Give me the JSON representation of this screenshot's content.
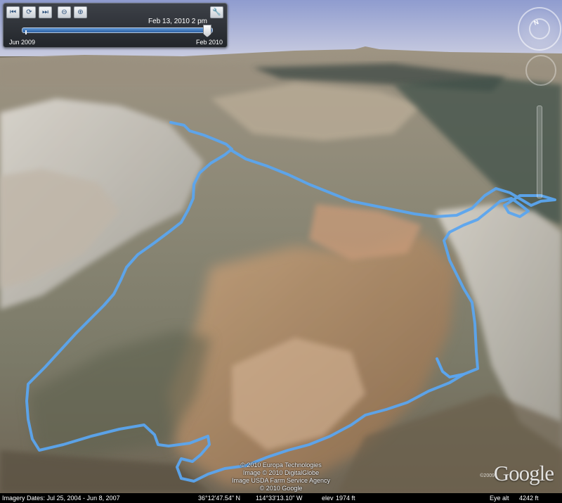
{
  "time_slider": {
    "current_date": "Feb 13, 2010   2 pm",
    "range_start": "Jun 2009",
    "range_end": "Feb 2010",
    "position_fraction": 0.97
  },
  "controls": {
    "back_icon": "step-back-icon",
    "play_icon": "history-play-icon",
    "forward_icon": "step-forward-icon",
    "zoom_out_icon": "zoom-out-icon",
    "zoom_in_icon": "zoom-in-icon",
    "settings_icon": "wrench-icon",
    "compass_label": "N"
  },
  "attribution": {
    "line1": "© 2010 Europa Technologies",
    "line2": "Image © 2010 DigitalGlobe",
    "line3": "Image USDA Farm Service Agency",
    "line4": "© 2010 Google",
    "logo": "Google",
    "logo_year": "©2009"
  },
  "status_bar": {
    "imagery_dates": "Imagery Dates: Jul 25, 2004 - Jun 8, 2007",
    "latitude": "36°12'47.54\" N",
    "longitude": "114°33'13.10\" W",
    "elev_label": "elev",
    "elev_value": "1974 ft",
    "eye_label": "Eye alt",
    "eye_value": "4242 ft"
  },
  "colors": {
    "track": "#5ba5ef",
    "sky": "#a9b1d4",
    "status_bar": "#000000"
  }
}
